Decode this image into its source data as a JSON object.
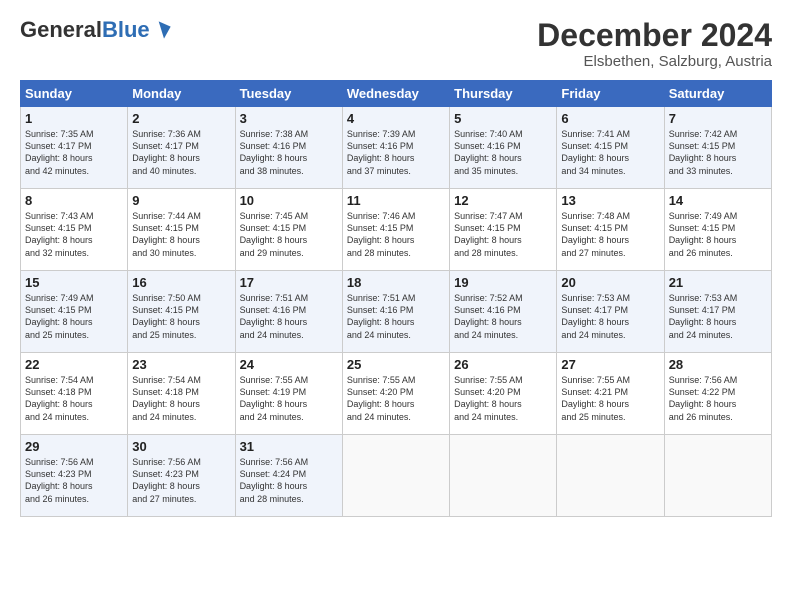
{
  "logo": {
    "general": "General",
    "blue": "Blue"
  },
  "title": "December 2024",
  "subtitle": "Elsbethen, Salzburg, Austria",
  "header_days": [
    "Sunday",
    "Monday",
    "Tuesday",
    "Wednesday",
    "Thursday",
    "Friday",
    "Saturday"
  ],
  "weeks": [
    [
      {
        "day": "1",
        "info": "Sunrise: 7:35 AM\nSunset: 4:17 PM\nDaylight: 8 hours\nand 42 minutes."
      },
      {
        "day": "2",
        "info": "Sunrise: 7:36 AM\nSunset: 4:17 PM\nDaylight: 8 hours\nand 40 minutes."
      },
      {
        "day": "3",
        "info": "Sunrise: 7:38 AM\nSunset: 4:16 PM\nDaylight: 8 hours\nand 38 minutes."
      },
      {
        "day": "4",
        "info": "Sunrise: 7:39 AM\nSunset: 4:16 PM\nDaylight: 8 hours\nand 37 minutes."
      },
      {
        "day": "5",
        "info": "Sunrise: 7:40 AM\nSunset: 4:16 PM\nDaylight: 8 hours\nand 35 minutes."
      },
      {
        "day": "6",
        "info": "Sunrise: 7:41 AM\nSunset: 4:15 PM\nDaylight: 8 hours\nand 34 minutes."
      },
      {
        "day": "7",
        "info": "Sunrise: 7:42 AM\nSunset: 4:15 PM\nDaylight: 8 hours\nand 33 minutes."
      }
    ],
    [
      {
        "day": "8",
        "info": "Sunrise: 7:43 AM\nSunset: 4:15 PM\nDaylight: 8 hours\nand 32 minutes."
      },
      {
        "day": "9",
        "info": "Sunrise: 7:44 AM\nSunset: 4:15 PM\nDaylight: 8 hours\nand 30 minutes."
      },
      {
        "day": "10",
        "info": "Sunrise: 7:45 AM\nSunset: 4:15 PM\nDaylight: 8 hours\nand 29 minutes."
      },
      {
        "day": "11",
        "info": "Sunrise: 7:46 AM\nSunset: 4:15 PM\nDaylight: 8 hours\nand 28 minutes."
      },
      {
        "day": "12",
        "info": "Sunrise: 7:47 AM\nSunset: 4:15 PM\nDaylight: 8 hours\nand 28 minutes."
      },
      {
        "day": "13",
        "info": "Sunrise: 7:48 AM\nSunset: 4:15 PM\nDaylight: 8 hours\nand 27 minutes."
      },
      {
        "day": "14",
        "info": "Sunrise: 7:49 AM\nSunset: 4:15 PM\nDaylight: 8 hours\nand 26 minutes."
      }
    ],
    [
      {
        "day": "15",
        "info": "Sunrise: 7:49 AM\nSunset: 4:15 PM\nDaylight: 8 hours\nand 25 minutes."
      },
      {
        "day": "16",
        "info": "Sunrise: 7:50 AM\nSunset: 4:15 PM\nDaylight: 8 hours\nand 25 minutes."
      },
      {
        "day": "17",
        "info": "Sunrise: 7:51 AM\nSunset: 4:16 PM\nDaylight: 8 hours\nand 24 minutes."
      },
      {
        "day": "18",
        "info": "Sunrise: 7:51 AM\nSunset: 4:16 PM\nDaylight: 8 hours\nand 24 minutes."
      },
      {
        "day": "19",
        "info": "Sunrise: 7:52 AM\nSunset: 4:16 PM\nDaylight: 8 hours\nand 24 minutes."
      },
      {
        "day": "20",
        "info": "Sunrise: 7:53 AM\nSunset: 4:17 PM\nDaylight: 8 hours\nand 24 minutes."
      },
      {
        "day": "21",
        "info": "Sunrise: 7:53 AM\nSunset: 4:17 PM\nDaylight: 8 hours\nand 24 minutes."
      }
    ],
    [
      {
        "day": "22",
        "info": "Sunrise: 7:54 AM\nSunset: 4:18 PM\nDaylight: 8 hours\nand 24 minutes."
      },
      {
        "day": "23",
        "info": "Sunrise: 7:54 AM\nSunset: 4:18 PM\nDaylight: 8 hours\nand 24 minutes."
      },
      {
        "day": "24",
        "info": "Sunrise: 7:55 AM\nSunset: 4:19 PM\nDaylight: 8 hours\nand 24 minutes."
      },
      {
        "day": "25",
        "info": "Sunrise: 7:55 AM\nSunset: 4:20 PM\nDaylight: 8 hours\nand 24 minutes."
      },
      {
        "day": "26",
        "info": "Sunrise: 7:55 AM\nSunset: 4:20 PM\nDaylight: 8 hours\nand 24 minutes."
      },
      {
        "day": "27",
        "info": "Sunrise: 7:55 AM\nSunset: 4:21 PM\nDaylight: 8 hours\nand 25 minutes."
      },
      {
        "day": "28",
        "info": "Sunrise: 7:56 AM\nSunset: 4:22 PM\nDaylight: 8 hours\nand 26 minutes."
      }
    ],
    [
      {
        "day": "29",
        "info": "Sunrise: 7:56 AM\nSunset: 4:23 PM\nDaylight: 8 hours\nand 26 minutes."
      },
      {
        "day": "30",
        "info": "Sunrise: 7:56 AM\nSunset: 4:23 PM\nDaylight: 8 hours\nand 27 minutes."
      },
      {
        "day": "31",
        "info": "Sunrise: 7:56 AM\nSunset: 4:24 PM\nDaylight: 8 hours\nand 28 minutes."
      },
      null,
      null,
      null,
      null
    ]
  ]
}
